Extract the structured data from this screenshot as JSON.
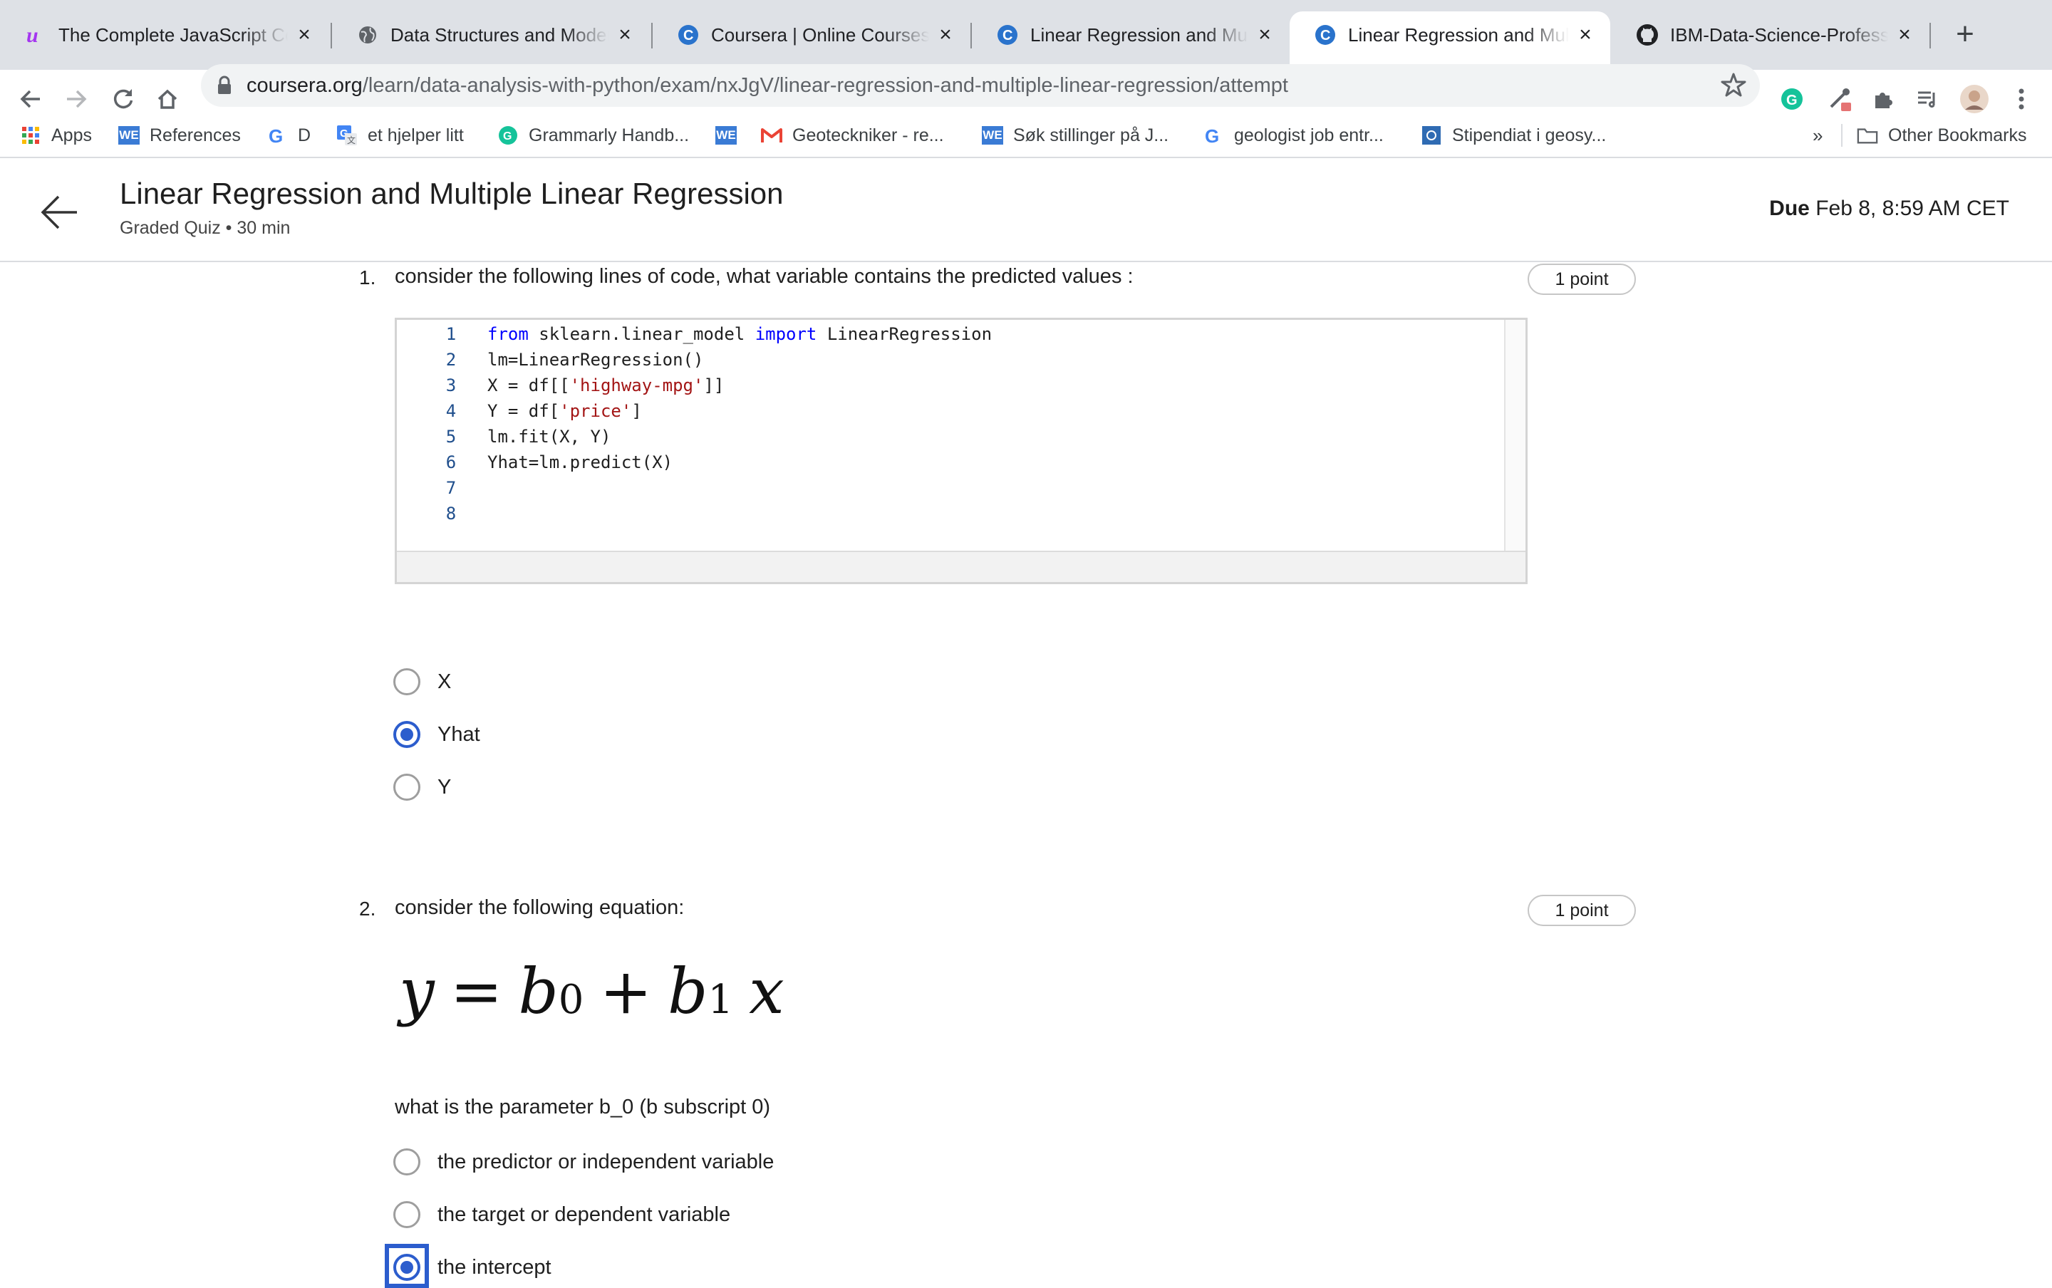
{
  "browser": {
    "tabs": [
      {
        "title": "The Complete JavaScript Co",
        "icon": "udemy-icon"
      },
      {
        "title": "Data Structures and Modern",
        "icon": "globe-icon"
      },
      {
        "title": "Coursera | Online Courses &",
        "icon": "coursera-icon"
      },
      {
        "title": "Linear Regression and Multi",
        "icon": "coursera-icon"
      },
      {
        "title": "Linear Regression and Multi",
        "icon": "coursera-icon",
        "active": true
      },
      {
        "title": "IBM-Data-Science-Professio",
        "icon": "github-icon"
      }
    ],
    "url_host": "coursera.org",
    "url_path": "/learn/data-analysis-with-python/exam/nxJgV/linear-regression-and-multiple-linear-regression/attempt",
    "bookmarks": [
      {
        "label": "Apps",
        "icon": "apps-grid-icon"
      },
      {
        "label": "References",
        "icon": "we-icon"
      },
      {
        "label": "D",
        "icon": "google-icon"
      },
      {
        "label": "et hjelper litt",
        "icon": "google-translate-icon"
      },
      {
        "label": "Grammarly Handb...",
        "icon": "grammarly-icon"
      },
      {
        "label": "",
        "icon": "we-icon"
      },
      {
        "label": "Geoteckniker - re...",
        "icon": "gmail-icon"
      },
      {
        "label": "Søk stillinger på J...",
        "icon": "we-icon"
      },
      {
        "label": "geologist job entr...",
        "icon": "google-icon"
      },
      {
        "label": "Stipendiat i geosy...",
        "icon": "bookmark-icon"
      }
    ],
    "bookmarks_overflow": "»",
    "other_bookmarks": "Other Bookmarks",
    "we_text": "WE",
    "colors": {
      "accent": "#2c5dcd",
      "tabstrip": "#dee1e6",
      "omnibox": "#f1f3f4"
    }
  },
  "header": {
    "title": "Linear Regression and Multiple Linear Regression",
    "subtitle": "Graded Quiz • 30 min",
    "due_label": "Due",
    "due_value": "Feb 8, 8:59 AM CET"
  },
  "questions": [
    {
      "number": "1.",
      "prompt": "consider the following lines of code, what variable contains the predicted values :",
      "points": "1 point",
      "code": {
        "line_numbers": [
          "1",
          "2",
          "3",
          "4",
          "5",
          "6",
          "7",
          "8"
        ],
        "l1": {
          "kw1": "from",
          "mid": " sklearn.linear_model ",
          "kw2": "import",
          "tail": " LinearRegression"
        },
        "l2": "lm=LinearRegression()",
        "l3": {
          "a": "X = df[[",
          "s": "'highway-mpg'",
          "b": "]]"
        },
        "l4": {
          "a": "Y = df[",
          "s": "'price'",
          "b": "]"
        },
        "l5": "lm.fit(X, Y)",
        "l6": "Yhat=lm.predict(X)"
      },
      "options": [
        {
          "label": "X",
          "selected": false
        },
        {
          "label": "Yhat",
          "selected": true
        },
        {
          "label": "Y",
          "selected": false
        }
      ]
    },
    {
      "number": "2.",
      "prompt": "consider the following equation:",
      "points": "1 point",
      "equation": {
        "y": "y",
        "eq": "=",
        "b": "b",
        "sub0": "0",
        "plus": "+",
        "sub1": "1",
        "x": "x"
      },
      "subprompt": "what is the parameter b_0 (b subscript 0)",
      "options": [
        {
          "label": "the predictor or independent variable",
          "selected": false
        },
        {
          "label": "the target or dependent variable",
          "selected": false
        },
        {
          "label": "the intercept",
          "selected": true
        }
      ]
    }
  ]
}
